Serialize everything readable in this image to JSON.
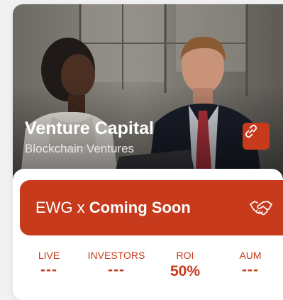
{
  "hero": {
    "title": "Venture Capital",
    "subtitle": "Blockchain Ventures",
    "link_icon": "link-icon"
  },
  "banner": {
    "prefix": "EWG x ",
    "status": "Coming Soon",
    "icon": "handshake-icon"
  },
  "stats": [
    {
      "label": "LIVE",
      "value": "---"
    },
    {
      "label": "INVESTORS",
      "value": "---"
    },
    {
      "label": "ROI",
      "value": "50%"
    },
    {
      "label": "AUM",
      "value": "---"
    }
  ],
  "colors": {
    "accent": "#c73a1c",
    "background": "#f2f1f1",
    "card": "#ffffff"
  }
}
